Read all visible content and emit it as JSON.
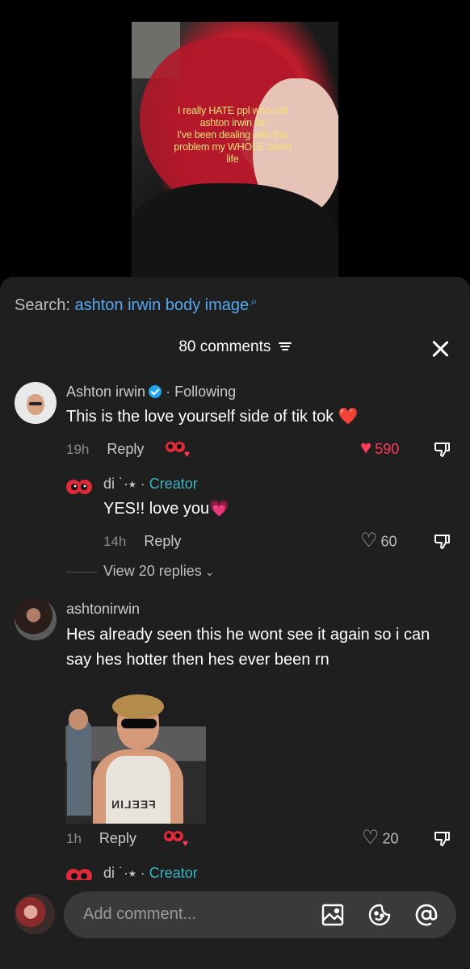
{
  "video": {
    "caption_lines": [
      "I really HATE ppl who call",
      "ashton irwin fat",
      "I've been dealing with this",
      "problem my WHOLE damn",
      "life"
    ]
  },
  "search": {
    "prefix": "Search: ",
    "term": "ashton irwin body image",
    "icon": "search-icon"
  },
  "comments_header": {
    "count_label": "80 comments",
    "filter_icon": "filter-icon",
    "close_icon": "close-icon"
  },
  "comments": [
    {
      "username": "Ashton irwin",
      "verified": true,
      "relation": "Following",
      "text": "This is the love yourself side of tik tok ❤️",
      "time": "19h",
      "reply_label": "Reply",
      "likes": "590",
      "liked": true
    },
    {
      "username": "di ˙·⭑",
      "role": "Creator",
      "text": "YES!! love you💗",
      "time": "14h",
      "reply_label": "Reply",
      "likes": "60",
      "liked": false
    },
    {
      "username": "ashtonirwin",
      "text": "Hes already seen this he wont see it again so i can say hes hotter then hes ever been rn",
      "photo_text": "FEELIN",
      "time": "1h",
      "reply_label": "Reply",
      "likes": "20",
      "liked": false
    },
    {
      "username": "di ˙·⭑",
      "role": "Creator"
    }
  ],
  "view_replies": "View 20 replies",
  "separator": "·",
  "bottom_bar": {
    "placeholder": "Add comment...",
    "icons": [
      "image-icon",
      "sticker-icon",
      "mention-icon"
    ]
  },
  "colors": {
    "sheet_bg": "#1f1f1f",
    "link_blue": "#56a9f2",
    "creator_teal": "#3bb4c6",
    "like_red": "#ff3b5c",
    "caption_yellow": "#f6e27a"
  }
}
